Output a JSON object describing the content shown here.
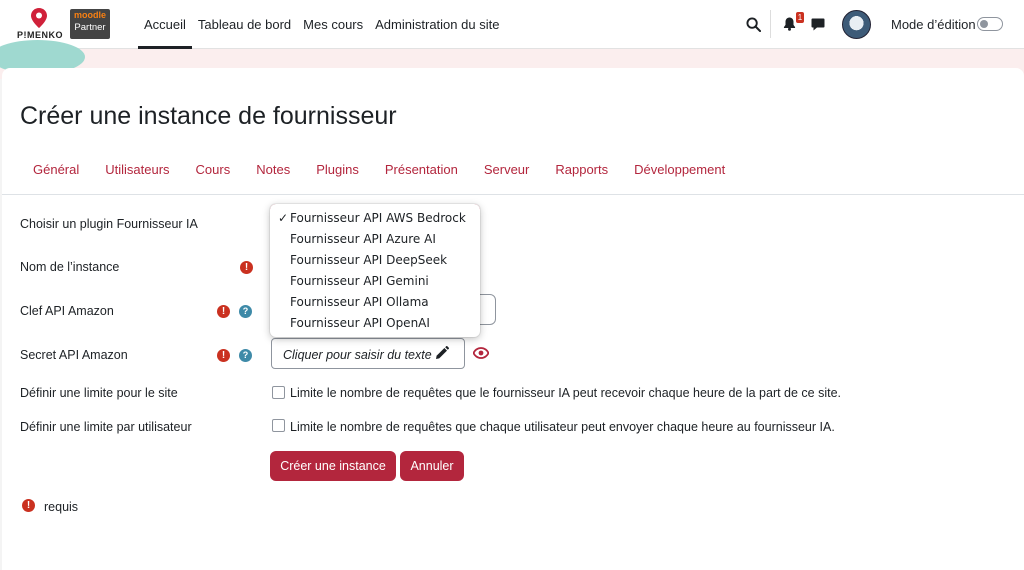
{
  "navbar": {
    "brand_text": "P!MENKO",
    "partner_top": "moodle",
    "partner_label": "Partner",
    "links": [
      "Accueil",
      "Tableau de bord",
      "Mes cours",
      "Administration du site"
    ],
    "active_link": "Accueil",
    "notification_count": "1",
    "edit_mode_label": "Mode d’édition",
    "edit_mode_on": false,
    "icons": [
      "search-icon",
      "bell-icon",
      "chat-icon",
      "avatar"
    ]
  },
  "page": {
    "title": "Créer une instance de fournisseur",
    "tabs": [
      "Général",
      "Utilisateurs",
      "Cours",
      "Notes",
      "Plugins",
      "Présentation",
      "Serveur",
      "Rapports",
      "Développement"
    ]
  },
  "form": {
    "plugin_label": "Choisir un plugin Fournisseur IA",
    "instance_name_label": "Nom de l’instance",
    "api_key_label": "Clef API Amazon",
    "api_secret_label": "Secret API Amazon",
    "api_secret_placeholder": "Cliquer pour saisir du texte",
    "site_limit_label": "Définir une limite pour le site",
    "site_limit_text": "Limite le nombre de requêtes que le fournisseur IA peut recevoir chaque heure de la part de ce site.",
    "user_limit_label": "Définir une limite par utilisateur",
    "user_limit_text": "Limite le nombre de requêtes que chaque utilisateur peut envoyer chaque heure au fournisseur IA.",
    "create_button": "Créer une instance",
    "cancel_button": "Annuler",
    "required_note": "requis"
  },
  "dropdown": {
    "selected": "Fournisseur API AWS Bedrock",
    "options": [
      "Fournisseur API AWS Bedrock",
      "Fournisseur API Azure AI",
      "Fournisseur API DeepSeek",
      "Fournisseur API Gemini",
      "Fournisseur API Ollama",
      "Fournisseur API OpenAI"
    ],
    "check_mark": "✓"
  },
  "colors": {
    "accent": "#b3263d",
    "required": "#ca3120",
    "help": "#3e8aa8"
  }
}
